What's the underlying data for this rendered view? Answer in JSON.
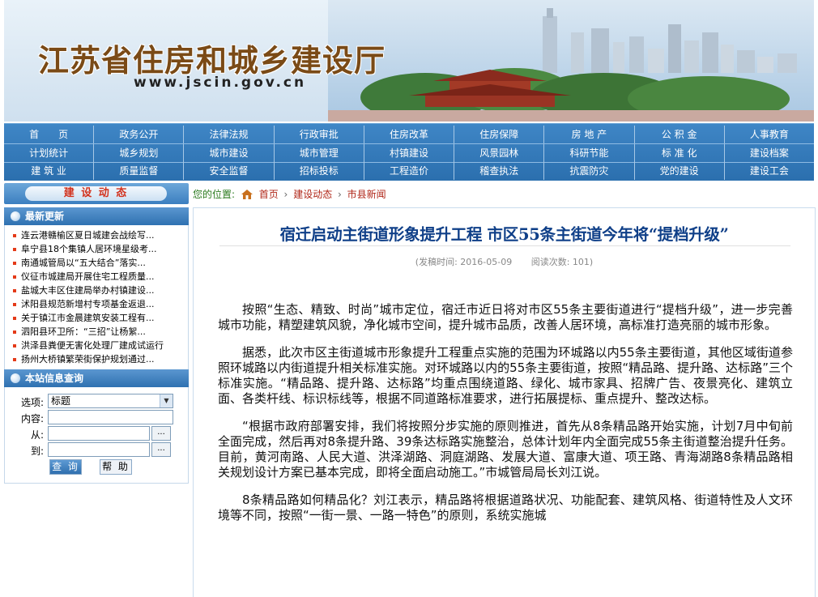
{
  "header": {
    "title": "江苏省住房和城乡建设厅",
    "url": "www.jscin.gov.cn"
  },
  "nav": {
    "rows": [
      [
        "首　　页",
        "政务公开",
        "法律法规",
        "行政审批",
        "住房改革",
        "住房保障",
        "房 地 产",
        "公 积 金",
        "人事教育"
      ],
      [
        "计划统计",
        "城乡规划",
        "城市建设",
        "城市管理",
        "村镇建设",
        "风景园林",
        "科研节能",
        "标 准 化",
        "建设档案"
      ],
      [
        "建 筑 业",
        "质量监督",
        "安全监督",
        "招标投标",
        "工程造价",
        "稽查执法",
        "抗震防灾",
        "党的建设",
        "建设工会"
      ]
    ]
  },
  "sidebar": {
    "category_label": "建 设 动 态",
    "latest_title": "最新更新",
    "latest_items": [
      "连云港赣榆区夏日城建会战绘写...",
      "阜宁县18个集镇人居环境星级考...",
      "南通城管局以“五大结合”落实...",
      "仪征市城建局开展住宅工程质量...",
      "盐城大丰区住建局举办村镇建设...",
      "沭阳县规范新增村专项基金返退...",
      "关于镇江市金晨建筑安装工程有...",
      "泗阳县环卫所：“三招”让杨絮...",
      "洪泽县粪便无害化处理厂建成试运行",
      "扬州大桥镇繁荣街保护规划通过..."
    ],
    "search": {
      "title": "本站信息查询",
      "option_label": "选项:",
      "option_value": "标题",
      "content_label": "内容:",
      "from_label": "从:",
      "to_label": "到:",
      "dots": "...",
      "query_button": "查 询",
      "help_button": "帮 助"
    }
  },
  "breadcrumb": {
    "prefix": "您的位置:",
    "items": [
      "首页",
      "建设动态",
      "市县新闻"
    ],
    "separator": "›"
  },
  "article": {
    "title": "宿迁启动主街道形象提升工程  市区55条主街道今年将“提档升级”",
    "publish_time": "(发稿时间: 2016-05-09",
    "views": "阅读次数: 101)",
    "paragraphs": [
      "按照“生态、精致、时尚”城市定位，宿迁市近日将对市区55条主要街道进行“提档升级”，进一步完善城市功能，精塑建筑风貌，净化城市空间，提升城市品质，改善人居环境，高标准打造亮丽的城市形象。",
      "据悉，此次市区主街道城市形象提升工程重点实施的范围为环城路以内55条主要街道，其他区域街道参照环城路以内街道提升相关标准实施。对环城路以内的55条主要街道，按照“精品路、提升路、达标路”三个标准实施。“精品路、提升路、达标路”均重点围绕道路、绿化、城市家具、招牌广告、夜景亮化、建筑立面、各类杆线、标识标线等，根据不同道路标准要求，进行拓展提标、重点提升、整改达标。",
      "“根据市政府部署安排，我们将按照分步实施的原则推进，首先从8条精品路开始实施，计划7月中旬前全面完成，然后再对8条提升路、39条达标路实施整治，总体计划年内全面完成55条主街道整治提升任务。目前，黄河南路、人民大道、洪泽湖路、洞庭湖路、发展大道、富康大道、项王路、青海湖路8条精品路相关规划设计方案已基本完成，即将全面启动施工。”市城管局局长刘江说。",
      "8条精品路如何精品化？刘江表示，精品路将根据道路状况、功能配套、建筑风格、街道特性及人文环境等不同，按照“一街一景、一路一特色”的原则，系统实施城"
    ]
  },
  "colors": {
    "nav_blue": "#2b6fae",
    "title_blue": "#0f3f88",
    "logo_brown": "#7a4a16",
    "accent_red": "#d2311c",
    "crumb_green": "#2a7a1e"
  }
}
